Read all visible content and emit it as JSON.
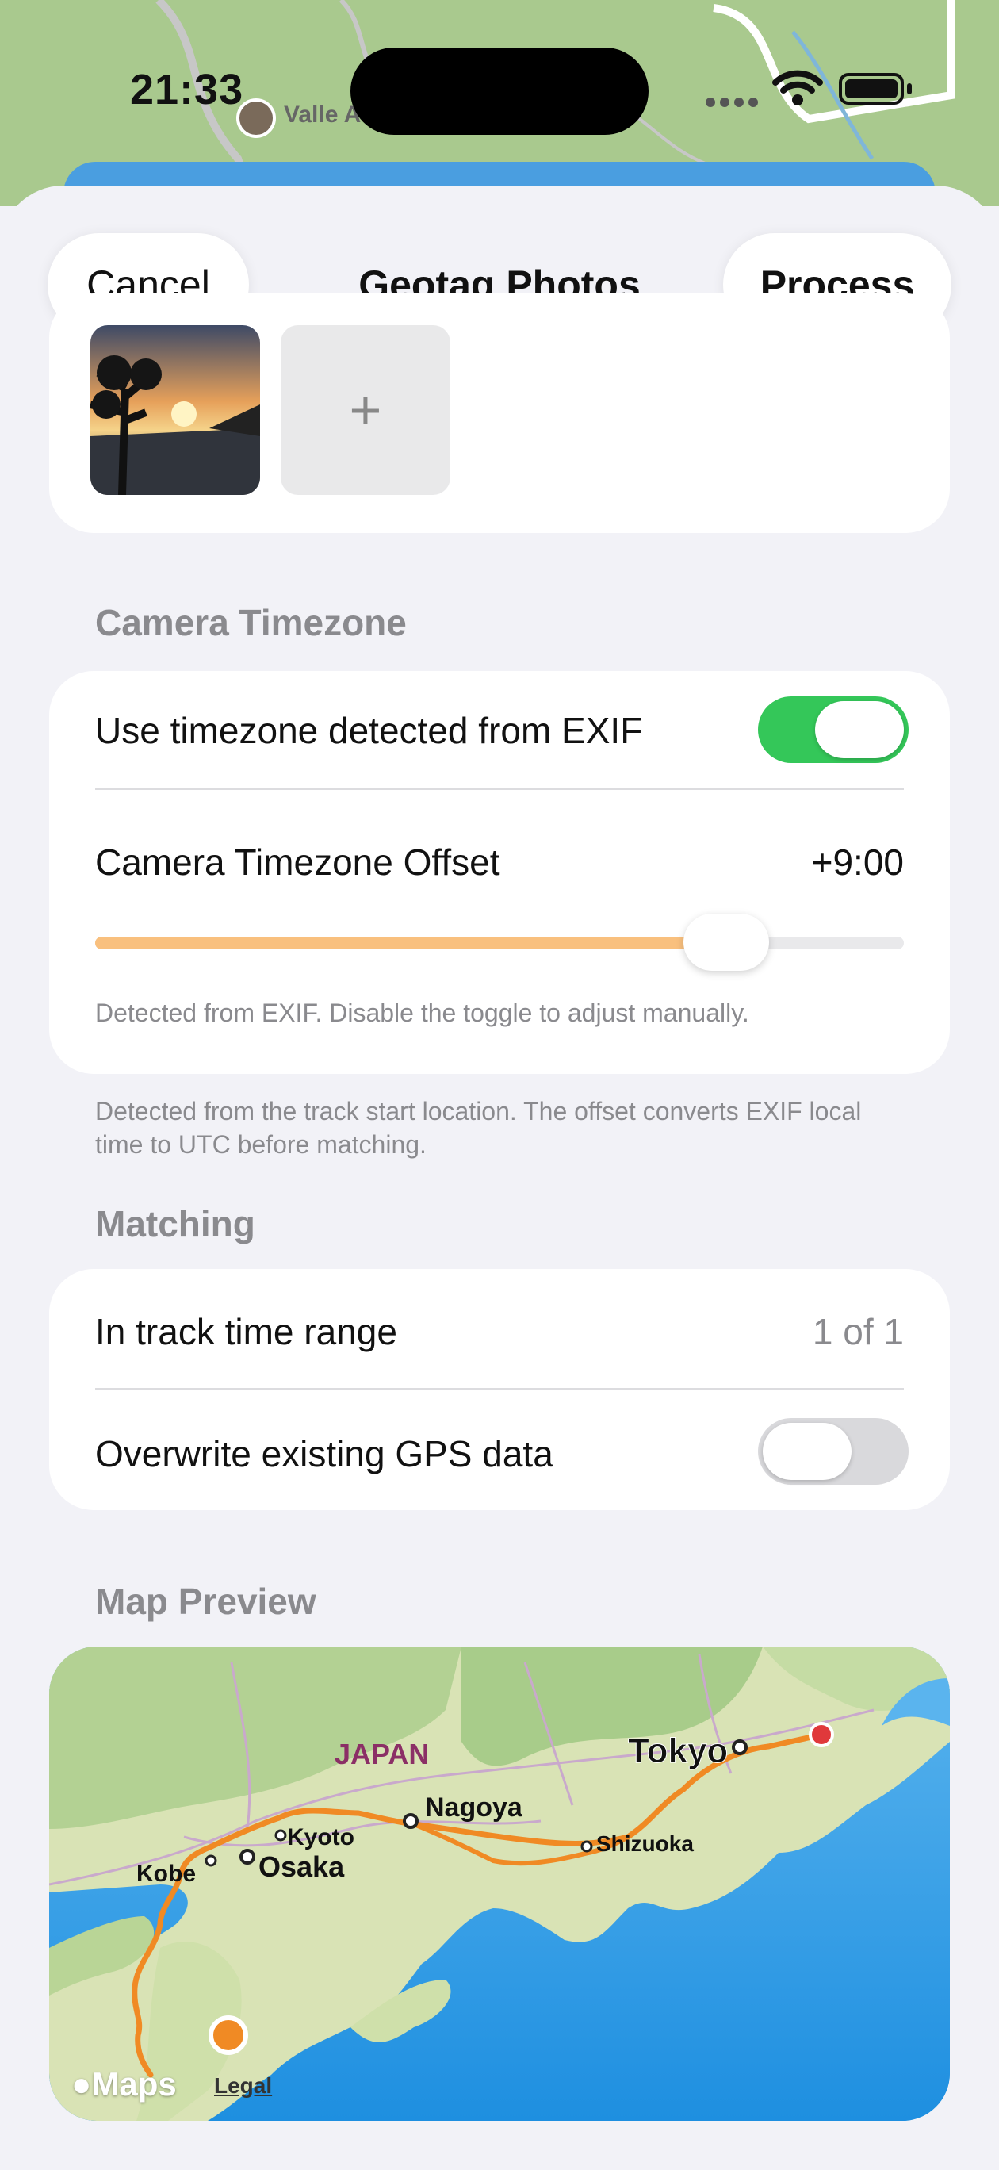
{
  "status_bar": {
    "time": "21:33",
    "map_place": "Valle A"
  },
  "nav": {
    "cancel_label": "Cancel",
    "title": "Geotag Photos",
    "process_label": "Process"
  },
  "photos": {
    "add_label": "+"
  },
  "camera_timezone": {
    "header": "Camera Timezone",
    "use_exif_label": "Use timezone detected from EXIF",
    "use_exif_on": true,
    "offset_label": "Camera Timezone Offset",
    "offset_value": "+9:00",
    "slider_fraction": 0.78,
    "helper": "Detected from EXIF. Disable the toggle to adjust manually.",
    "footer": "Detected from the track start location. The offset converts EXIF local time to UTC before matching."
  },
  "matching": {
    "header": "Matching",
    "range_label": "In track time range",
    "range_value": "1 of 1",
    "overwrite_label": "Overwrite existing GPS data",
    "overwrite_on": false
  },
  "map_preview": {
    "header": "Map Preview",
    "country": "JAPAN",
    "cities": [
      "Tokyo",
      "Nagoya",
      "Kyoto",
      "Osaka",
      "Kobe",
      "Shizuoka"
    ],
    "brand": "Maps",
    "legal": "Legal"
  },
  "colors": {
    "accent_green": "#34c759",
    "slider_fill": "#f9c07e",
    "track": "#f08a24",
    "end_point": "#e0393b"
  }
}
